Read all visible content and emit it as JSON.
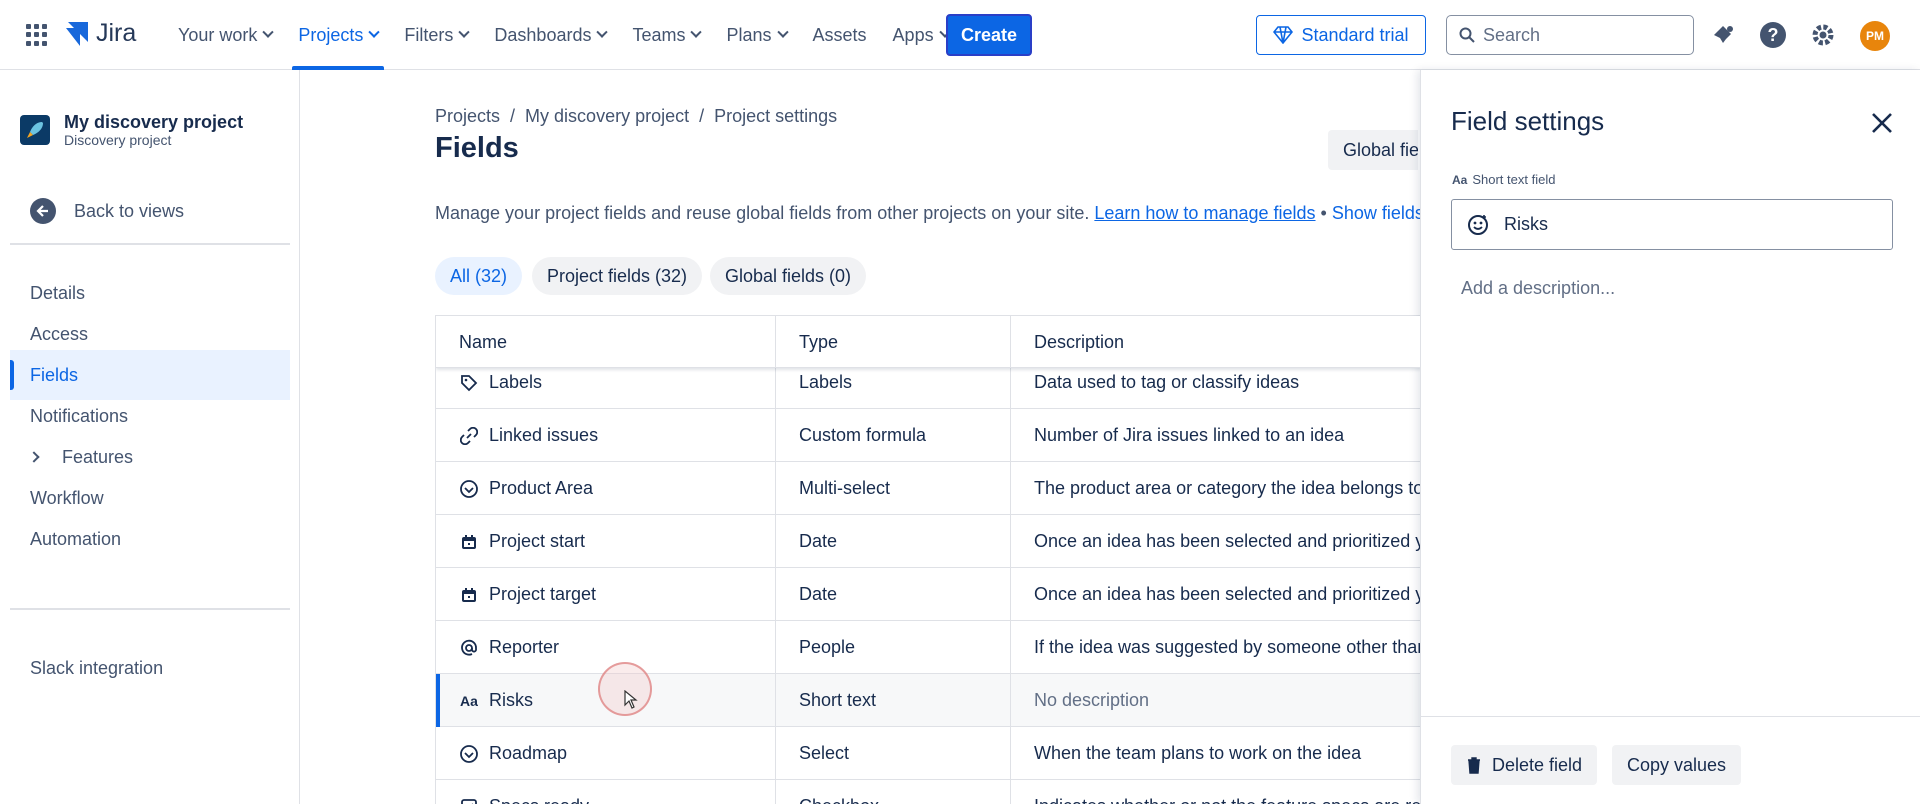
{
  "topnav": {
    "logo": "Jira",
    "items": [
      {
        "label": "Your work",
        "chevron": true
      },
      {
        "label": "Projects",
        "chevron": true,
        "active": true
      },
      {
        "label": "Filters",
        "chevron": true
      },
      {
        "label": "Dashboards",
        "chevron": true
      },
      {
        "label": "Teams",
        "chevron": true
      },
      {
        "label": "Plans",
        "chevron": true
      },
      {
        "label": "Assets",
        "chevron": false
      },
      {
        "label": "Apps",
        "chevron": true
      }
    ],
    "create_label": "Create",
    "trial_label": "Standard trial",
    "search_placeholder": "Search",
    "avatar_initials": "PM",
    "accent": "#0c66e4"
  },
  "sidebar": {
    "project_name": "My discovery project",
    "project_type": "Discovery project",
    "back_label": "Back to views",
    "items": [
      {
        "label": "Details"
      },
      {
        "label": "Access"
      },
      {
        "label": "Fields",
        "active": true
      },
      {
        "label": "Notifications"
      },
      {
        "label": "Features",
        "expandable": true
      },
      {
        "label": "Workflow"
      },
      {
        "label": "Automation"
      }
    ],
    "integration_label": "Slack integration"
  },
  "main": {
    "breadcrumb": [
      "Projects",
      "My discovery project",
      "Project settings"
    ],
    "breadcrumb_sep": "/",
    "title": "Fields",
    "global_button": "Global fie",
    "description": "Manage your project fields and reuse global fields from other projects on your site.",
    "learn_link": "Learn how to manage fields",
    "bullet": "•",
    "show_link": "Show fields to",
    "filters": [
      {
        "label": "All (32)",
        "active": true
      },
      {
        "label": "Project fields (32)"
      },
      {
        "label": "Global fields (0)"
      }
    ],
    "table": {
      "headers": [
        "Name",
        "Type",
        "Description"
      ],
      "rows": [
        {
          "icon": "tag-icon",
          "name": "Labels",
          "type": "Labels",
          "description": "Data used to tag or classify ideas"
        },
        {
          "icon": "link-icon",
          "name": "Linked issues",
          "type": "Custom formula",
          "description": "Number of Jira issues linked to an idea"
        },
        {
          "icon": "select-icon",
          "name": "Product Area",
          "type": "Multi-select",
          "description": "The product area or category the idea belongs to"
        },
        {
          "icon": "calendar-icon",
          "name": "Project start",
          "type": "Date",
          "description": "Once an idea has been selected and prioritized you"
        },
        {
          "icon": "calendar-icon",
          "name": "Project target",
          "type": "Date",
          "description": "Once an idea has been selected and prioritized you"
        },
        {
          "icon": "at-icon",
          "name": "Reporter",
          "type": "People",
          "description": "If the idea was suggested by someone other than"
        },
        {
          "icon": "short-text-icon",
          "name": "Risks",
          "type": "Short text",
          "description": "No description",
          "selected": true,
          "muted": true
        },
        {
          "icon": "select-icon",
          "name": "Roadmap",
          "type": "Select",
          "description": "When the team plans to work on the idea"
        },
        {
          "icon": "checkbox-icon",
          "name": "Specs ready",
          "type": "Checkbox",
          "description": "Indicates whether or not the feature specs are read"
        }
      ]
    }
  },
  "panel": {
    "title": "Field settings",
    "field_kind_glyph": "Aa",
    "field_kind": "Short text field",
    "field_name": "Risks",
    "description_placeholder": "Add a description...",
    "delete_label": "Delete field",
    "copy_label": "Copy values"
  }
}
